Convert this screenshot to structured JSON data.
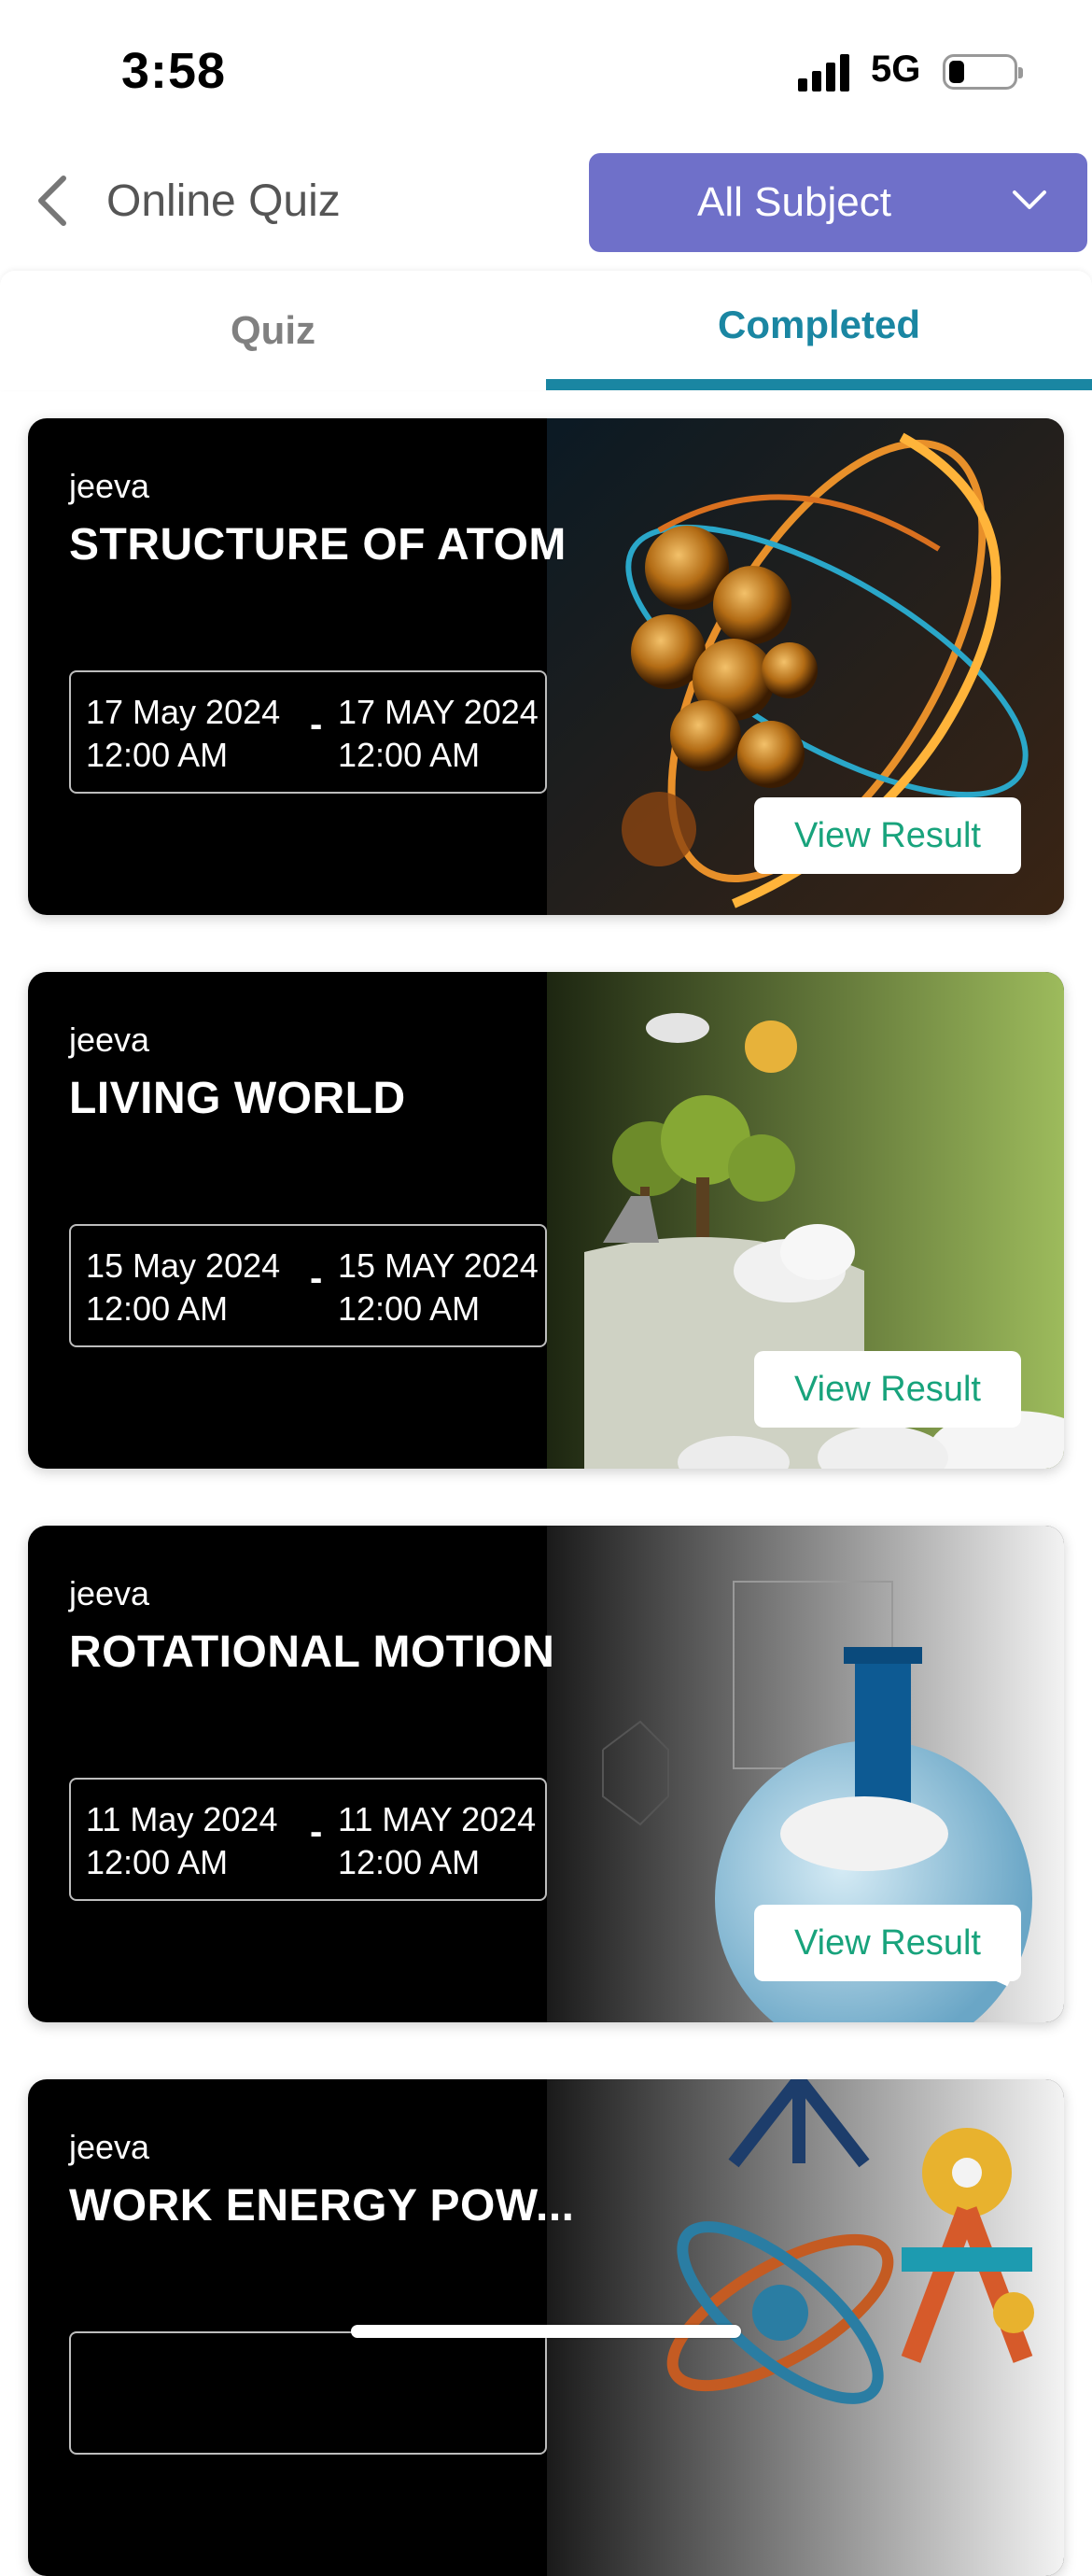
{
  "status_bar": {
    "time": "3:58",
    "network": "5G"
  },
  "header": {
    "back_icon": "chevron-left-icon",
    "title": "Online Quiz",
    "subject_filter": "All Subject",
    "filter_icon": "chevron-down-icon"
  },
  "tabs": [
    {
      "label": "Quiz",
      "active": false
    },
    {
      "label": "Completed",
      "active": true
    }
  ],
  "colors": {
    "accent": "#6f70c9",
    "tab_active": "#1a86a2",
    "result_text": "#18a37c"
  },
  "cards": [
    {
      "author": "jeeva",
      "title": "STRUCTURE OF ATOM",
      "start_date": "17 May 2024",
      "start_time": "12:00 AM",
      "separator": "-",
      "end_date": "17 MAY 2024",
      "end_time": "12:00 AM",
      "action": "View Result",
      "image": "atom-image"
    },
    {
      "author": "jeeva",
      "title": "LIVING WORLD",
      "start_date": "15 May 2024",
      "start_time": "12:00 AM",
      "separator": "-",
      "end_date": "15 MAY 2024",
      "end_time": "12:00 AM",
      "action": "View Result",
      "image": "nature-image"
    },
    {
      "author": "jeeva",
      "title": "ROTATIONAL MOTION",
      "start_date": "11 May 2024",
      "start_time": "12:00 AM",
      "separator": "-",
      "end_date": "11 MAY 2024",
      "end_time": "12:00 AM",
      "action": "View Result",
      "image": "flask-image"
    },
    {
      "author": "jeeva",
      "title": "WORK ENERGY POW...",
      "image": "science-tools-image"
    }
  ]
}
